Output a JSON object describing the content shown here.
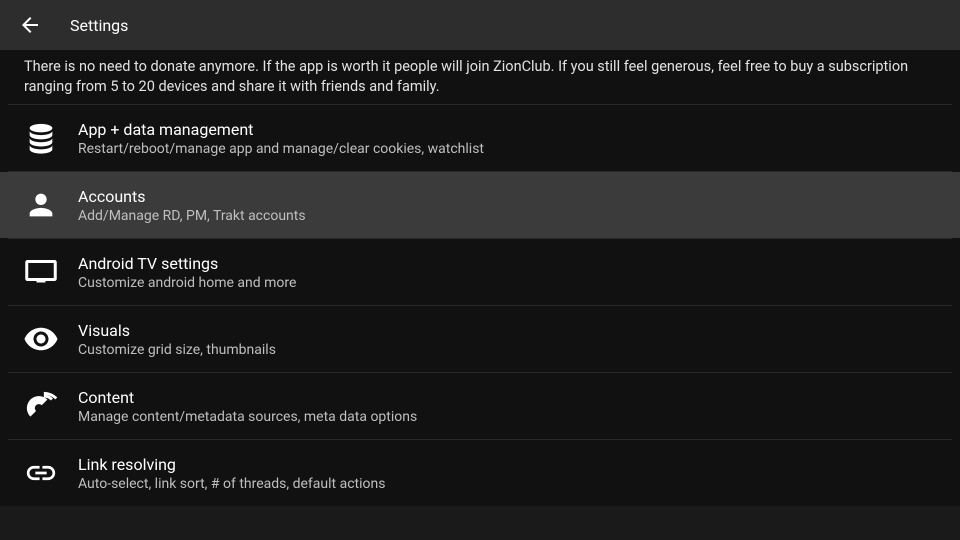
{
  "header": {
    "title": "Settings"
  },
  "intro": "There is no need to donate anymore. If the app is worth it people will join ZionClub. If you still feel generous, feel free to buy a subscription ranging from 5 to 20 devices and share it with friends and family.",
  "items": [
    {
      "icon": "database-icon",
      "title": "App + data management",
      "subtitle": "Restart/reboot/manage app and manage/clear cookies, watchlist",
      "selected": false
    },
    {
      "icon": "person-icon",
      "title": "Accounts",
      "subtitle": "Add/Manage RD, PM, Trakt accounts",
      "selected": true
    },
    {
      "icon": "tv-icon",
      "title": "Android TV settings",
      "subtitle": "Customize android home and more",
      "selected": false
    },
    {
      "icon": "eye-icon",
      "title": "Visuals",
      "subtitle": "Customize grid size, thumbnails",
      "selected": false
    },
    {
      "icon": "satellite-icon",
      "title": "Content",
      "subtitle": "Manage content/metadata sources, meta data options",
      "selected": false
    },
    {
      "icon": "link-icon",
      "title": "Link resolving",
      "subtitle": "Auto-select, link sort, # of threads, default actions",
      "selected": false
    }
  ]
}
